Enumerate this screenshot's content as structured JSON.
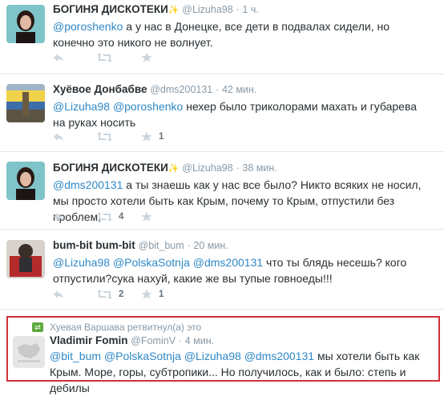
{
  "tweets": [
    {
      "name": "БОГИНЯ ДИСКОТЕКИ",
      "handle": "@Lizuha98",
      "time": "1 ч.",
      "segments": [
        {
          "text": "@poroshenko",
          "mention": true
        },
        {
          "text": " а у нас в Донецке, все дети в подвалах сидели, но конечно это никого не волнует.",
          "mention": false
        }
      ],
      "retweet_count": "",
      "favorite_count": ""
    },
    {
      "name": "Хуёвое Донбабве",
      "handle": "@dms200131",
      "time": "42 мин.",
      "segments": [
        {
          "text": "@Lizuha98",
          "mention": true
        },
        {
          "text": " ",
          "mention": false
        },
        {
          "text": "@poroshenko",
          "mention": true
        },
        {
          "text": " нехер было триколорами махать и губарева на руках носить",
          "mention": false
        }
      ],
      "retweet_count": "",
      "favorite_count": "1"
    },
    {
      "name": "БОГИНЯ ДИСКОТЕКИ",
      "handle": "@Lizuha98",
      "time": "38 мин.",
      "segments": [
        {
          "text": "@dms200131",
          "mention": true
        },
        {
          "text": " а ты знаешь как у нас все было? Никто всяких не носил, мы просто хотели быть как Крым, почему то Крым, отпустили  без проблем,",
          "mention": false
        }
      ],
      "retweet_count": "4",
      "favorite_count": ""
    },
    {
      "name": "bum-bit bum-bit",
      "handle": "@bit_bum",
      "time": "20 мин.",
      "segments": [
        {
          "text": "@Lizuha98",
          "mention": true
        },
        {
          "text": " ",
          "mention": false
        },
        {
          "text": "@PolskaSotnja",
          "mention": true
        },
        {
          "text": " ",
          "mention": false
        },
        {
          "text": "@dms200131",
          "mention": true
        },
        {
          "text": " что ты блядь несешь? кого отпустили?сука нахуй, какие же вы тупые говноеды!!!",
          "mention": false
        }
      ],
      "retweet_count": "2",
      "favorite_count": "1"
    },
    {
      "retweeted_by": "Хуевая Варшава ретвитнул(а) это",
      "name": "Vladimir Fomin",
      "handle": "@FominV",
      "time": "4 мин.",
      "segments": [
        {
          "text": "@bit_bum",
          "mention": true
        },
        {
          "text": " ",
          "mention": false
        },
        {
          "text": "@PolskaSotnja",
          "mention": true
        },
        {
          "text": " ",
          "mention": false
        },
        {
          "text": "@Lizuha98",
          "mention": true
        },
        {
          "text": " ",
          "mention": false
        },
        {
          "text": "@dms200131",
          "mention": true
        },
        {
          "text": " мы хотели быть как Крым. Море, горы, субтропики... Но получилось, как и было: степь и дебилы",
          "mention": false
        }
      ]
    }
  ],
  "sep": "·",
  "icons": {
    "reply": "reply-icon",
    "retweet": "retweet-icon",
    "favorite": "star-icon",
    "sparkle": "sparkle-icon"
  },
  "colors": {
    "link": "#2f88c7",
    "highlight": "#d0303a",
    "muted": "#8899a6",
    "retweet_badge": "#5daa3e"
  }
}
